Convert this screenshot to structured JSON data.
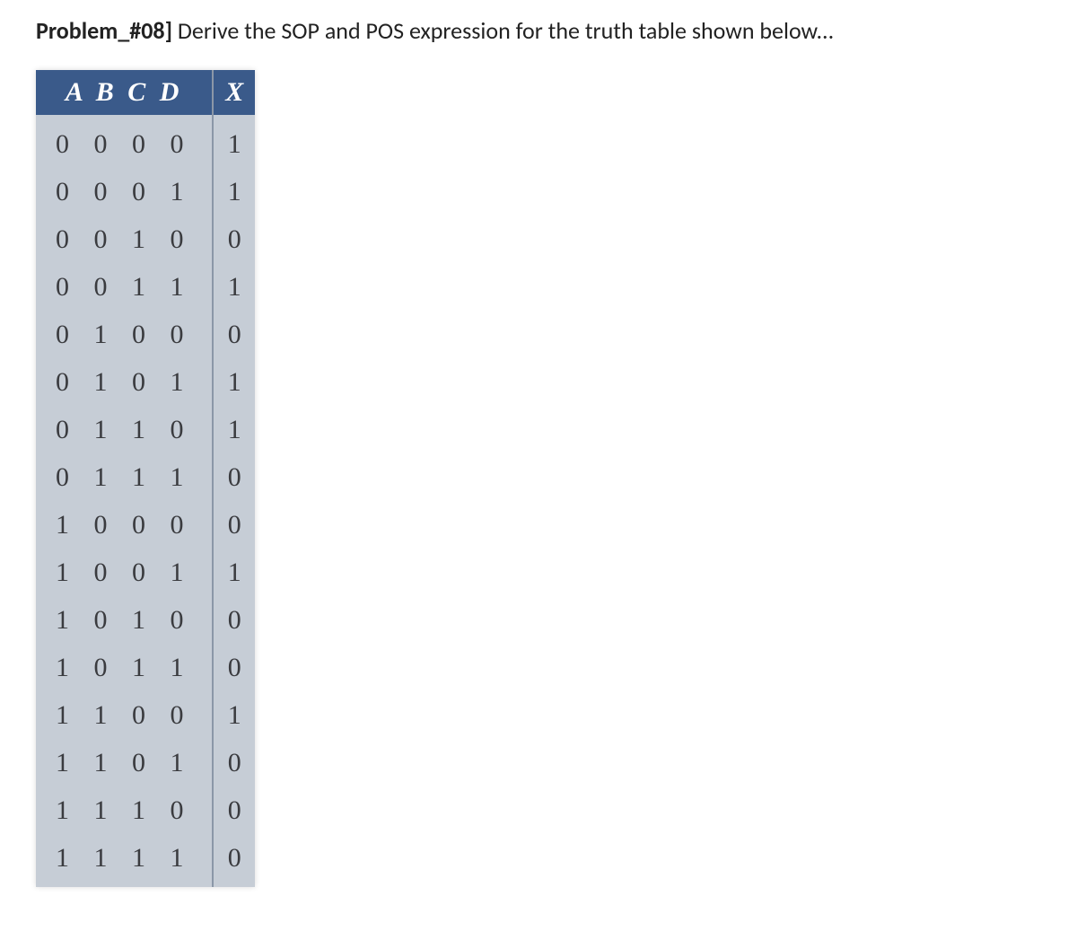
{
  "problem": {
    "label": "Problem_#08]",
    "text": "Derive the SOP and POS expression for the truth table shown below..."
  },
  "table": {
    "headers": {
      "inputs": "A B C D",
      "output": "X"
    },
    "rows": [
      {
        "inputs": "0 0 0 0",
        "output": "1"
      },
      {
        "inputs": "0 0 0 1",
        "output": "1"
      },
      {
        "inputs": "0 0 1 0",
        "output": "0"
      },
      {
        "inputs": "0 0 1 1",
        "output": "1"
      },
      {
        "inputs": "0 1 0 0",
        "output": "0"
      },
      {
        "inputs": "0 1 0 1",
        "output": "1"
      },
      {
        "inputs": "0 1 1 0",
        "output": "1"
      },
      {
        "inputs": "0 1 1 1",
        "output": "0"
      },
      {
        "inputs": "1 0 0 0",
        "output": "0"
      },
      {
        "inputs": "1 0 0 1",
        "output": "1"
      },
      {
        "inputs": "1 0 1 0",
        "output": "0"
      },
      {
        "inputs": "1 0 1 1",
        "output": "0"
      },
      {
        "inputs": "1 1 0 0",
        "output": "1"
      },
      {
        "inputs": "1 1 0 1",
        "output": "0"
      },
      {
        "inputs": "1 1 1 0",
        "output": "0"
      },
      {
        "inputs": "1 1 1 1",
        "output": "0"
      }
    ]
  }
}
